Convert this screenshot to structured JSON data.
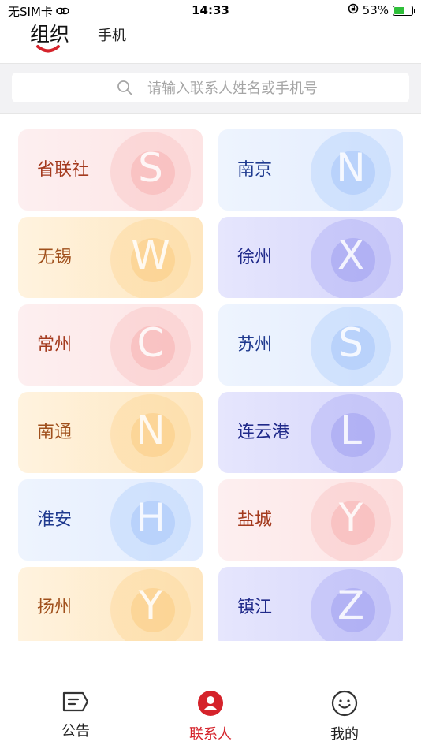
{
  "status_bar": {
    "carrier": "无SIM卡",
    "time": "14:33",
    "battery": "53%",
    "battery_level": 0.53
  },
  "header": {
    "tab_org": "组织",
    "tab_phone": "手机"
  },
  "search": {
    "placeholder": "请输入联系人姓名或手机号"
  },
  "cards": [
    {
      "name": "省联社",
      "letter": "S"
    },
    {
      "name": "南京",
      "letter": "N"
    },
    {
      "name": "无锡",
      "letter": "W"
    },
    {
      "name": "徐州",
      "letter": "X"
    },
    {
      "name": "常州",
      "letter": "C"
    },
    {
      "name": "苏州",
      "letter": "S"
    },
    {
      "name": "南通",
      "letter": "N"
    },
    {
      "name": "连云港",
      "letter": "L"
    },
    {
      "name": "淮安",
      "letter": "H"
    },
    {
      "name": "盐城",
      "letter": "Y"
    },
    {
      "name": "扬州",
      "letter": "Y"
    },
    {
      "name": "镇江",
      "letter": "Z"
    }
  ],
  "tabbar": {
    "announcement": "公告",
    "contacts": "联系人",
    "mine": "我的"
  },
  "colors": {
    "accent": "#d5232b",
    "pink_text": "#a43a1e",
    "blue_text": "#1f3a8f"
  },
  "icons": [
    "wifi-link-icon",
    "orientation-lock-icon",
    "battery-icon",
    "search-icon",
    "announcement-icon",
    "contacts-icon",
    "smile-icon"
  ]
}
